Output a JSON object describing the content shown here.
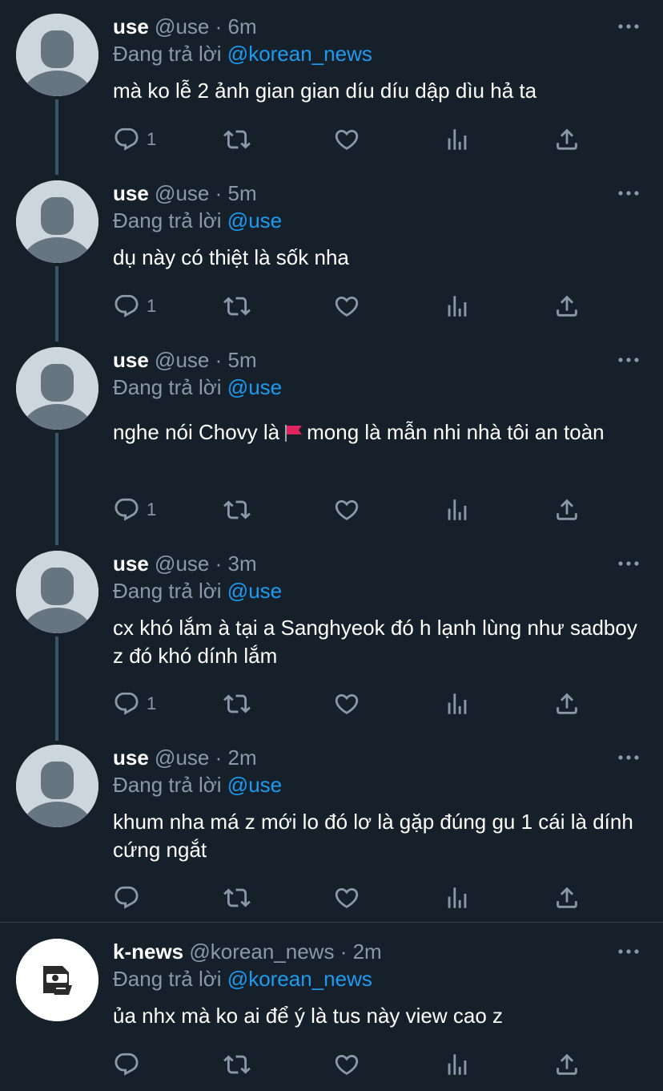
{
  "colors": {
    "background": "#15202b",
    "text": "#ffffff",
    "muted": "#8b98a5",
    "mention": "#1d9bf0",
    "thread_line": "#3d5466",
    "flag": "#e0245e"
  },
  "tweets": [
    {
      "name": "use",
      "handle": "@use",
      "time": "· 6m",
      "reply_prefix": "Đang trả lời",
      "reply_to": "@korean_news",
      "text": "mà ko lễ 2 ảnh gian gian díu díu dập dìu hả ta",
      "reply_count": "1",
      "avatar": "default-avatar-icon"
    },
    {
      "name": "use",
      "handle": "@use",
      "time": "· 5m",
      "reply_prefix": "Đang trả lời",
      "reply_to": "@use",
      "text": "dụ này có thiệt là sốk nha",
      "reply_count": "1",
      "avatar": "default-avatar-icon"
    },
    {
      "name": "use",
      "handle": "@use",
      "time": "· 5m",
      "reply_prefix": "Đang trả lời",
      "reply_to": "@use",
      "text_before_flag": "nghe nói Chovy là",
      "text_after_flag": "mong là mẫn nhi nhà tôi an toàn",
      "flag_icon": "red-flag-emoji",
      "reply_count": "1",
      "avatar": "default-avatar-icon"
    },
    {
      "name": "use",
      "handle": "@use",
      "time": "· 3m",
      "reply_prefix": "Đang trả lời",
      "reply_to": "@use",
      "text": "cx khó lắm à tại a Sanghyeok đó h lạnh lùng như sadboy z đó khó dính lắm",
      "reply_count": "1",
      "avatar": "default-avatar-icon"
    },
    {
      "name": "use",
      "handle": "@use",
      "time": "· 2m",
      "reply_prefix": "Đang trả lời",
      "reply_to": "@use",
      "text": "khum nha má z mới lo đó lơ là gặp đúng gu 1 cái là dính cứng ngắt",
      "reply_count": "",
      "avatar": "default-avatar-icon"
    },
    {
      "name": "k-news",
      "handle": "@korean_news",
      "time": "· 2m",
      "reply_prefix": "Đang trả lời",
      "reply_to": "@korean_news",
      "text": "ủa nhx mà ko ai để ý là tus này view cao z",
      "reply_count": "",
      "avatar": "k-news-logo-icon"
    }
  ],
  "icons": {
    "more": "more-dots-icon",
    "reply": "reply-bubble-icon",
    "retweet": "retweet-icon",
    "like": "heart-icon",
    "views": "analytics-bars-icon",
    "share": "share-upload-icon"
  }
}
